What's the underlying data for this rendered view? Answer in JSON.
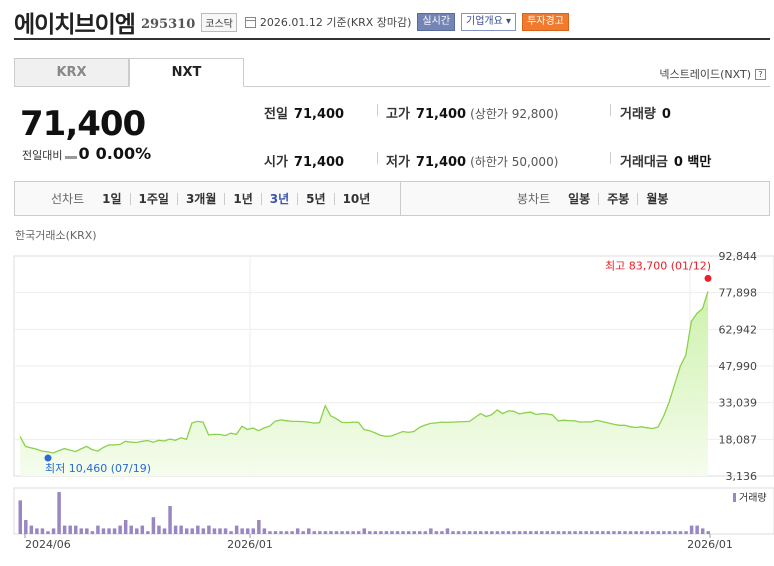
{
  "header": {
    "name": "에이치브이엠",
    "code": "295310",
    "market": "코스닥",
    "date": "2026.01.12",
    "basis": "기준(KRX 장마감)",
    "live_btn": "실시간",
    "overview_btn": "기업개요",
    "overview_icon": "caret-down-icon",
    "warn_btn": "투자경고"
  },
  "tabs": [
    "KRX",
    "NXT"
  ],
  "nxt_link": "넥스트레이드(NXT)",
  "price": {
    "current": "71,400",
    "change_label": "전일대비",
    "change": "0",
    "change_pct": "0.00%"
  },
  "stats": {
    "prev": {
      "label": "전일",
      "value": "71,400"
    },
    "high": {
      "label": "고가",
      "value": "71,400",
      "sub": "(상한가 92,800)"
    },
    "volume": {
      "label": "거래량",
      "value": "0"
    },
    "open": {
      "label": "시가",
      "value": "71,400"
    },
    "low": {
      "label": "저가",
      "value": "71,400",
      "sub": "(하한가 50,000)"
    },
    "amount": {
      "label": "거래대금",
      "value": "0 백만"
    }
  },
  "period_bar": {
    "line_label": "선차트",
    "line_items": [
      "1일",
      "1주일",
      "3개월",
      "1년",
      "3년",
      "5년",
      "10년"
    ],
    "active": "3년",
    "candle_label": "봉차트",
    "candle_items": [
      "일봉",
      "주봉",
      "월봉"
    ]
  },
  "exchange_label": "한국거래소(KRX)",
  "colors": {
    "line": "#8ad24a",
    "volume": "#9b86c4",
    "max_dot": "#e8202a",
    "min_dot": "#2a6bd1"
  },
  "chart_data": {
    "type": "area",
    "y_ticks": [
      "92,844",
      "77,898",
      "62,942",
      "47,990",
      "33,039",
      "18,087",
      "3,136"
    ],
    "ylim": [
      3136,
      92844
    ],
    "x_ticks": [
      "2024/06",
      "2026/01",
      "2026/01"
    ],
    "max_label": "최고 83,700 (01/12)",
    "min_label": "최저 10,460 (07/19)",
    "volume_label": "거래량",
    "series": [
      {
        "values": [
          19300,
          15200,
          14600,
          14100,
          13300,
          13000,
          12500,
          13500,
          14300,
          13700,
          13100,
          14200,
          15200,
          13900,
          13300,
          14700,
          15800,
          15800,
          16000,
          17300,
          16900,
          16800,
          17300,
          17600,
          16900,
          17700,
          17400,
          18200,
          17700,
          18700,
          18100,
          24800,
          25400,
          25100,
          19900,
          20100,
          20100,
          19600,
          20600,
          20100,
          23400,
          22100,
          22700,
          21600,
          22700,
          23500,
          25500,
          26000,
          25700,
          25400,
          25400,
          25300,
          25100,
          24700,
          24900,
          31800,
          27700,
          26500,
          25000,
          24900,
          25100,
          25000,
          22100,
          21600,
          20700,
          19700,
          19300,
          19500,
          20400,
          21300,
          20900,
          21300,
          23000,
          23900,
          24600,
          24800,
          25100,
          25000,
          25100,
          25200,
          25300,
          25400,
          27000,
          28600,
          27400,
          28100,
          30100,
          28600,
          29700,
          29500,
          28400,
          28900,
          29200,
          28200,
          28600,
          28400,
          28000,
          25600,
          25900,
          25700,
          25600,
          25100,
          25200,
          25200,
          25800,
          25300,
          24800,
          24200,
          23800,
          23800,
          23200,
          22900,
          23200,
          22800,
          22500,
          23100,
          27500,
          33300,
          40600,
          47900,
          52400,
          66200,
          69400,
          71400,
          78400
        ]
      }
    ],
    "volume": [
      12,
      5,
      3,
      2,
      2,
      1,
      2,
      15,
      3,
      3,
      3,
      2,
      2,
      1,
      3,
      2,
      2,
      2,
      3,
      5,
      3,
      2,
      3,
      1,
      6,
      3,
      2,
      10,
      3,
      3,
      2,
      2,
      3,
      2,
      3,
      2,
      2,
      2,
      1,
      3,
      2,
      2,
      2,
      5,
      2,
      1,
      1,
      1,
      1,
      1,
      2,
      1,
      2,
      1,
      1,
      1,
      1,
      1,
      1,
      1,
      1,
      1,
      2,
      1,
      1,
      1,
      1,
      1,
      1,
      1,
      1,
      1,
      1,
      1,
      2,
      1,
      1,
      2,
      1,
      1,
      1,
      1,
      1,
      1,
      1,
      1,
      1,
      1,
      1,
      1,
      1,
      1,
      1,
      1,
      1,
      1,
      1,
      1,
      1,
      1,
      1,
      1,
      1,
      1,
      1,
      1,
      1,
      1,
      1,
      1,
      1,
      1,
      1,
      1,
      1,
      1,
      1,
      1,
      1,
      1,
      1,
      3,
      3,
      2,
      1
    ]
  }
}
